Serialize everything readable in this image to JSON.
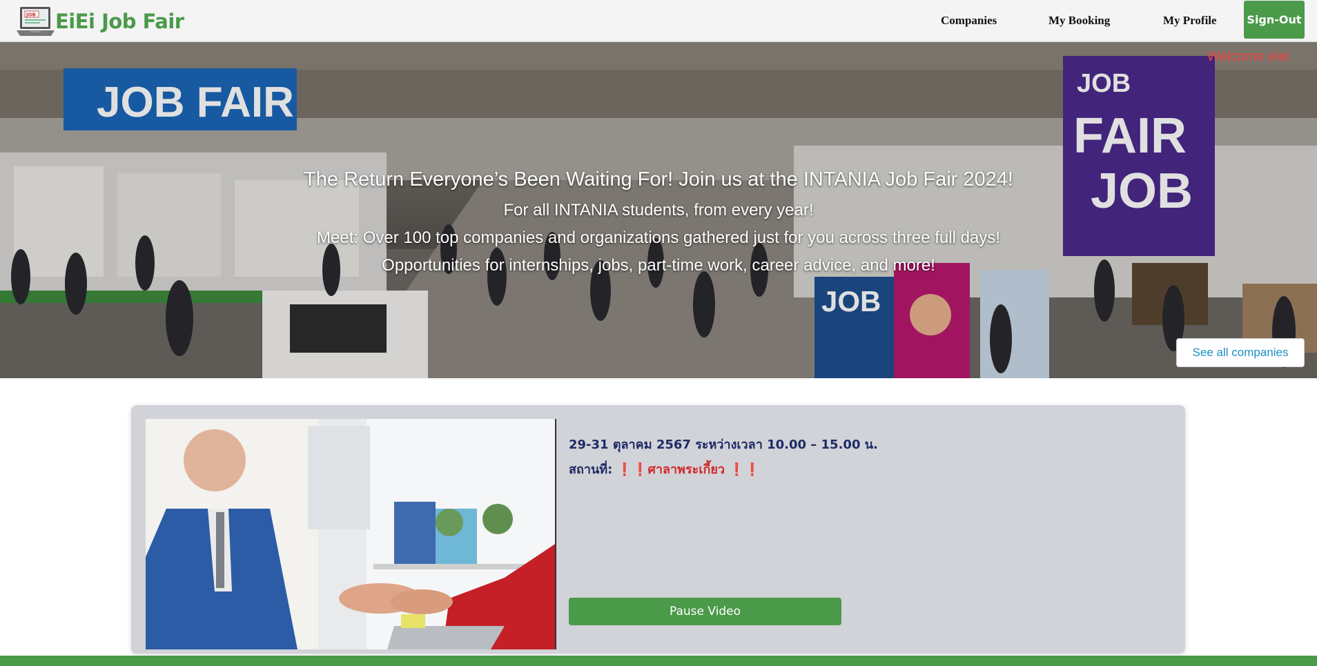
{
  "navbar": {
    "logo_text": "EiEi Job Fair",
    "logo_monitor_text": "JOB",
    "links": {
      "companies": "Companies",
      "my_booking": "My Booking",
      "my_profile": "My Profile"
    },
    "signout_label": "Sign-Out"
  },
  "hero": {
    "welcome": "Welcome eiei",
    "title": "The Return Everyone’s Been Waiting For! Join us at the INTANIA Job Fair 2024!",
    "line1": "For all INTANIA students, from every year!",
    "line2": "Meet: Over 100 top companies and organizations gathered just for you across three full days!",
    "line3": "Opportunities for internships, jobs, part-time work, career advice, and more!",
    "sign_left": "JOB FAIR",
    "sign_right_1": "JOB",
    "sign_right_2": "FAIR",
    "banner_job": "JOB",
    "see_all_label": "See all companies"
  },
  "event": {
    "date_text": "29-31 ตุลาคม 2567 ระหว่างเวลา 10.00 – 15.00 น.",
    "venue_label": "สถานที่: ",
    "venue_name": "❗❗ศาลาพระเกี้ยว ❗❗",
    "pause_label": "Pause Video"
  },
  "colors": {
    "brand_green": "#4a9a4a",
    "welcome_red": "#f04545",
    "info_navy": "#1f2a66",
    "venue_red": "#d22a2a",
    "link_blue": "#1a8fc4"
  }
}
